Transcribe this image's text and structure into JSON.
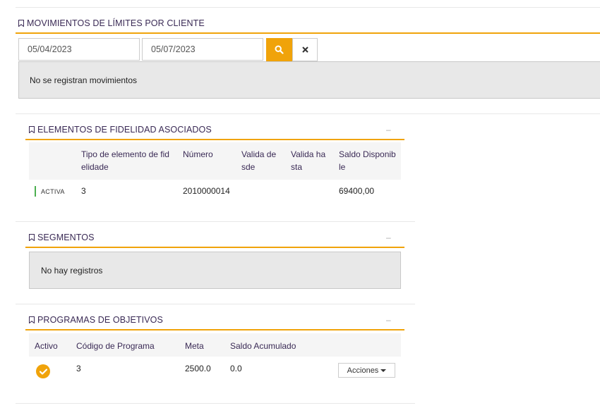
{
  "movimientos": {
    "title": "MOVIMIENTOS DE LÍMITES POR CLIENTE",
    "date_from": "05/04/2023",
    "date_to": "05/07/2023",
    "empty_message": "No se registran movimientos"
  },
  "fidelidad": {
    "title": "ELEMENTOS DE FIDELIDAD ASOCIADOS",
    "collapse": "–",
    "columns": {
      "tipo_l1": "Tipo de elemento de fid",
      "tipo_l2": "elidade",
      "numero": "Número",
      "desde_l1": "Valida de",
      "desde_l2": "sde",
      "hasta_l1": "Valida ha",
      "hasta_l2": "sta",
      "saldo_l1": "Saldo Disponib",
      "saldo_l2": "le"
    },
    "rows": [
      {
        "status": "ACTIVA",
        "tipo": "3",
        "numero": "2010000014",
        "desde": "",
        "hasta": "",
        "saldo": "69400,00"
      }
    ]
  },
  "segmentos": {
    "title": "SEGMENTOS",
    "collapse": "–",
    "empty_message": "No hay registros"
  },
  "programas": {
    "title": "PROGRAMAS DE OBJETIVOS",
    "collapse": "–",
    "columns": {
      "activo": "Activo",
      "codigo": "Código de Programa",
      "meta": "Meta",
      "saldo": "Saldo Acumulado"
    },
    "rows": [
      {
        "codigo": "3",
        "meta": "2500.0",
        "saldo": "0.0",
        "action_label": "Acciones"
      }
    ]
  },
  "colors": {
    "accent": "#f0a30a",
    "title": "#3a2a55",
    "status_active": "#4caf50",
    "gray_box": "#e8e8e8"
  },
  "icons": {
    "section": "bookmark-icon",
    "search": "search-icon",
    "clear": "close-icon",
    "active": "check-circle-icon",
    "dropdown": "caret-down-icon"
  }
}
